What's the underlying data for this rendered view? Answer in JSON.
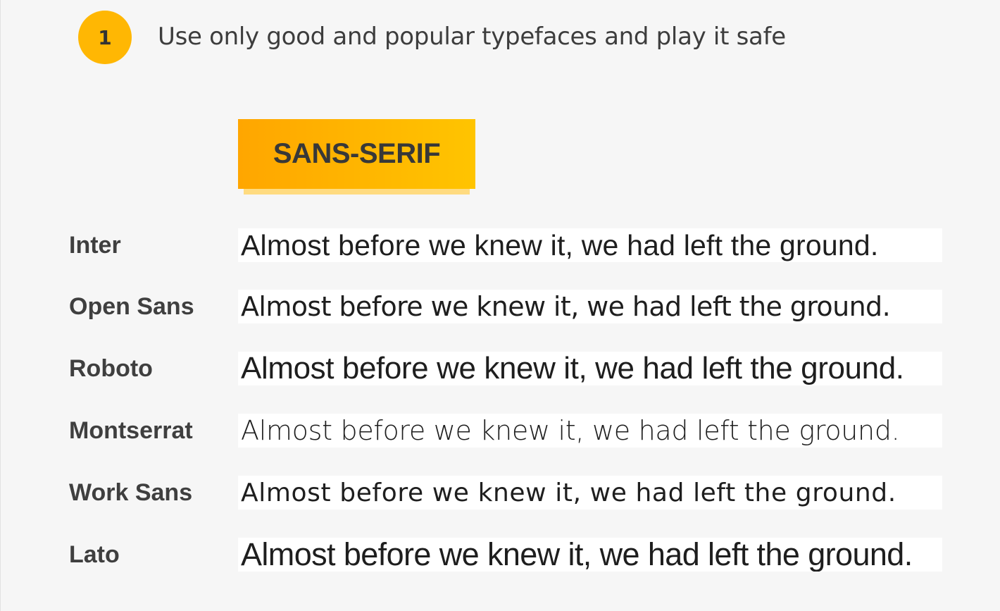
{
  "step": {
    "number": "1",
    "heading": "Use only good and popular typefaces and play it safe"
  },
  "category": {
    "label": "SANS-SERIF",
    "colors": {
      "gradient_start": "#ffa600",
      "gradient_end": "#ffc400",
      "shadow": "#ffdb80"
    }
  },
  "typefaces": [
    {
      "name": "Inter",
      "sample": "Almost before we knew it, we had left the ground."
    },
    {
      "name": "Open Sans",
      "sample": "Almost before we knew it, we had left the ground."
    },
    {
      "name": "Roboto",
      "sample": "Almost before we knew it, we had left the ground."
    },
    {
      "name": "Montserrat",
      "sample": "Almost before we knew it, we had left the ground."
    },
    {
      "name": "Work Sans",
      "sample": "Almost before we knew it, we had left the ground."
    },
    {
      "name": "Lato",
      "sample": "Almost before we knew it, we had left the ground."
    }
  ],
  "colors": {
    "background": "#f6f6f6",
    "badge": "#ffb703",
    "text": "#3a3a3a"
  }
}
